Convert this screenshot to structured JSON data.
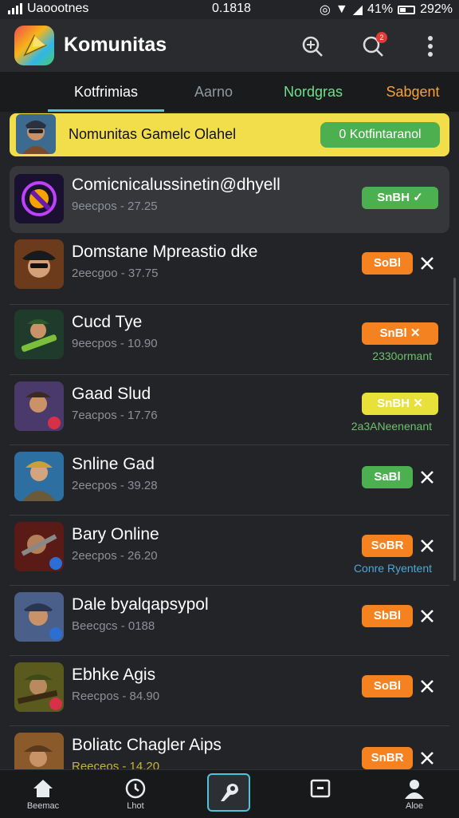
{
  "status": {
    "carrier": "Uaoootnes",
    "time": "0.1818",
    "battery_text": "41%",
    "extra": "292%"
  },
  "app": {
    "title": "Komunitas",
    "notif_count": "2"
  },
  "tabs": [
    "Kotfrimias",
    "Aarno",
    "Nordgras",
    "Sabgent"
  ],
  "banner": {
    "title": "Nomunitas Gamelc Olahel",
    "button": "0 Kotfintaranol"
  },
  "rows": [
    {
      "title": "Comicnicalussinetin@dhyell",
      "sub": "9eecpos - 27.25",
      "action": "SnBH",
      "action_color": "green",
      "check": true
    },
    {
      "title": "Domstane Mpreastio dke",
      "sub": "2eecgoo - 37.75",
      "action": "SoBl",
      "action_color": "orange"
    },
    {
      "title": "Cucd Tye",
      "sub": "9eecpos - 10.90",
      "action": "SnBl",
      "action_color": "orange",
      "note": "2330ormant"
    },
    {
      "title": "Gaad Slud",
      "sub": "7eacpos - 17.76",
      "action": "SnBH",
      "action_color": "yellow",
      "note": "2a3ANeenenant"
    },
    {
      "title": "Snline Gad",
      "sub": "2eecpos - 39.28",
      "action": "SaBl",
      "action_color": "green"
    },
    {
      "title": "Bary Online",
      "sub": "2eecpos - 26.20",
      "action": "SoBR",
      "action_color": "orange",
      "note": "Conre Ryentent"
    },
    {
      "title": "Dale byalqapsypol",
      "sub": "Beecgcs - 0188",
      "action": "SbBl",
      "action_color": "orange"
    },
    {
      "title": "Ebhke Agis",
      "sub": "Reecpos - 84.90",
      "action": "SoBl",
      "action_color": "orange"
    },
    {
      "title": "Boliatc Chagler Aips",
      "sub": "Reeceos - 14.20",
      "action": "SnBR",
      "action_color": "orange"
    }
  ],
  "bottom_nav": [
    "Beemac",
    "Lhot",
    "",
    "",
    "Aloe"
  ],
  "colors": {
    "accent": "#4fc3d7",
    "banner": "#f1de4a",
    "orange": "#f58220",
    "green": "#4caf50",
    "yellow": "#e8e13a"
  }
}
